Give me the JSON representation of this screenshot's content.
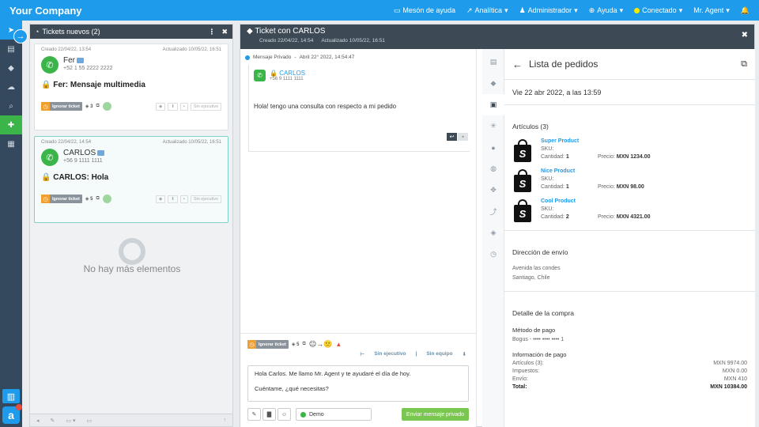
{
  "topbar": {
    "brand": "Your Company",
    "nav": [
      {
        "icon": "monitor-icon",
        "glyph": "▭",
        "label": "Mesón de ayuda"
      },
      {
        "icon": "chart-icon",
        "glyph": "↗",
        "label": "Analítica"
      },
      {
        "icon": "user-icon",
        "glyph": "♟",
        "label": "Administrador"
      },
      {
        "icon": "globe-icon",
        "glyph": "⊕",
        "label": "Ayuda"
      },
      {
        "icon": "status-dot-icon",
        "glyph": "",
        "label": "Conectado"
      },
      {
        "icon": "",
        "glyph": "",
        "label": "Mr. Agent"
      }
    ],
    "bell_glyph": "🔔"
  },
  "left_panel": {
    "title": "Tickets nuevos (2)",
    "menu_glyph": "⋮",
    "close_glyph": "✖",
    "tickets": [
      {
        "created": "Creado 22/04/22, 13:54",
        "updated": "Actualizado 10/05/22, 16:51",
        "name": "Fer",
        "phone": "+52 1 55 2222 2222",
        "subject": "Fer: Mensaje multimedia",
        "ignore_label": "Ignorar ticket",
        "tag_count": "3",
        "no_exec": "Sin ejecutivo"
      },
      {
        "created": "Creado 22/04/22, 14:54",
        "updated": "Actualizado 10/05/22, 16:51",
        "name": "CARLOS",
        "phone": "+56 9 1111 1111",
        "subject": "CARLOS: Hola",
        "ignore_label": "Ignorar ticket",
        "tag_count": "5",
        "no_exec": "Sin ejecutivo"
      }
    ],
    "empty_text": "No hay más elementos"
  },
  "mid_panel": {
    "title": "Ticket con CARLOS",
    "created": "Creado 22/04/22, 14:54",
    "updated": "Actualizado 10/05/22, 16:51",
    "close_glyph": "✖",
    "message": {
      "label": "Mensaje Privado",
      "date": "Abril 22° 2022, 14:54:47",
      "name": "CARLOS",
      "phone": "+56 9 1111 1111",
      "text": "Hola! tengo una consulta con respecto a mi pedido"
    },
    "compose": {
      "ignore_label": "Ignorar ticket",
      "tag_count": "5",
      "emoji": "😐→🙁",
      "no_exec": "Sin ejecutivo",
      "no_team": "Sin equipo",
      "line1": "Hola Carlos. Me llamo Mr. Agent y te ayudaré el día de hoy.",
      "line2": "Cuéntame, ¿qué necesitas?",
      "channel": "Demo",
      "send_label": "Enviar mensaje privado"
    }
  },
  "orders": {
    "title": "Lista de pedidos",
    "date": "Vie 22 abr 2022, a las 13:59",
    "articles_title": "Artículos (3)",
    "products": [
      {
        "name": "Super Product",
        "sku": "SKU:",
        "qty_label": "Cantidad:",
        "qty": "1",
        "price_label": "Precio:",
        "price": "MXN 1234.00"
      },
      {
        "name": "Nice Product",
        "sku": "SKU:",
        "qty_label": "Cantidad:",
        "qty": "1",
        "price_label": "Precio:",
        "price": "MXN 98.00"
      },
      {
        "name": "Cool Product",
        "sku": "SKU:",
        "qty_label": "Cantidad:",
        "qty": "2",
        "price_label": "Precio:",
        "price": "MXN 4321.00"
      }
    ],
    "shipping_title": "Dirección de envío",
    "address1": "Avenida las condes",
    "address2": "Santiago, Chile",
    "detail_title": "Detalle de la compra",
    "payment_method_label": "Método de pago",
    "payment_method": "Bogus - •••• •••• •••• 1",
    "payment_info_label": "Información de pago",
    "rows": [
      {
        "k": "Artículos (3):",
        "v": "MXN 9974.00"
      },
      {
        "k": "Impuestos:",
        "v": "MXN 0.00"
      },
      {
        "k": "Envío:",
        "v": "MXN 410"
      }
    ],
    "total_label": "Total:",
    "total_value": "MXN 10384.00"
  }
}
